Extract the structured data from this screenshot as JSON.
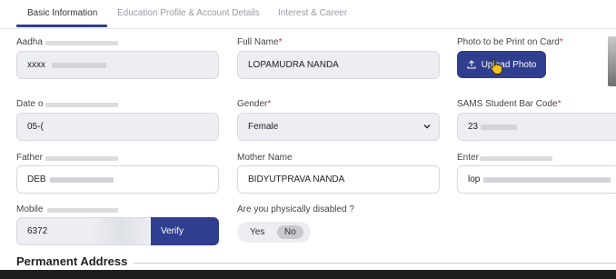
{
  "tabs": [
    {
      "label": "Basic Information",
      "active": true
    },
    {
      "label": "Education Profile & Account Details",
      "active": false
    },
    {
      "label": "Interest & Career",
      "active": false
    }
  ],
  "fields": {
    "aadhaar": {
      "label": "Aadha",
      "value": "xxxx"
    },
    "full_name": {
      "label": "Full Name",
      "required": "*",
      "value": "LOPAMUDRA NANDA"
    },
    "photo": {
      "label": "Photo to be Print on Card",
      "required": "*",
      "button": "Upload Photo"
    },
    "dob": {
      "label": "Date o",
      "value": "05-("
    },
    "gender": {
      "label": "Gender",
      "required": "*",
      "value": "Female",
      "options": [
        "Female"
      ]
    },
    "sams": {
      "label": "SAMS Student Bar Code",
      "required": "*",
      "value": "23"
    },
    "father": {
      "label": "Father",
      "value": "DEB"
    },
    "mother": {
      "label": "Mother Name",
      "value": "BIDYUTPRAVA NANDA"
    },
    "email": {
      "label": "Enter",
      "value": "lop"
    },
    "mobile": {
      "label": "Mobile",
      "value": "6372",
      "button": "Verify"
    },
    "disabled": {
      "label": "Are you physically disabled ?",
      "options": [
        "Yes",
        "No"
      ],
      "selected": "No"
    }
  },
  "section": {
    "title": "Permanent Address"
  },
  "colors": {
    "primary": "#2f3e8f",
    "field_bg": "#eceef3",
    "border": "#d9d9df"
  },
  "icons": {
    "upload": "upload-icon",
    "select": "chevron-down-icon",
    "cursor": "hand-cursor-icon"
  }
}
